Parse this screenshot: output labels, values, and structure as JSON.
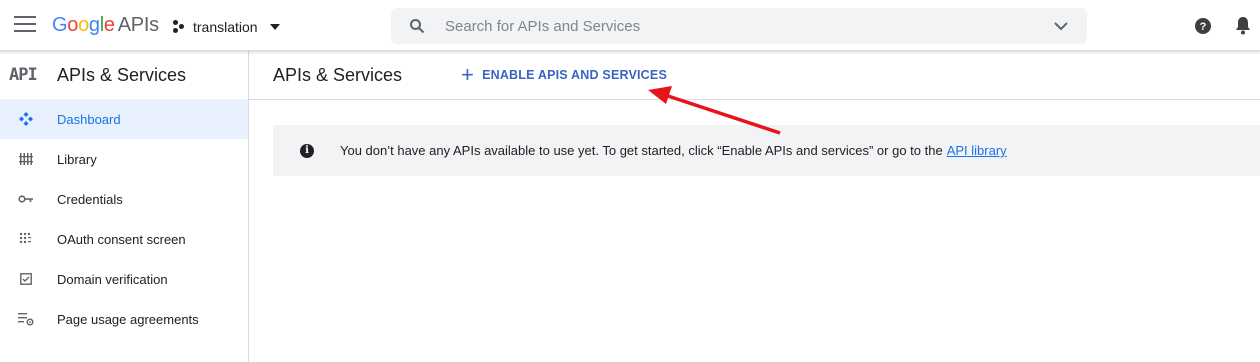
{
  "header": {
    "logo": {
      "g1": "G",
      "o1": "o",
      "o2": "o",
      "g2": "g",
      "l": "l",
      "e": "e",
      "suffix": "APIs"
    },
    "project_name": "translation",
    "search_placeholder": "Search for APIs and Services"
  },
  "sidebar": {
    "logo_text": "API",
    "title": "APIs & Services",
    "items": [
      {
        "label": "Dashboard",
        "icon": "dashboard-icon",
        "active": true
      },
      {
        "label": "Library",
        "icon": "library-icon",
        "active": false
      },
      {
        "label": "Credentials",
        "icon": "key-icon",
        "active": false
      },
      {
        "label": "OAuth consent screen",
        "icon": "oauth-consent-icon",
        "active": false
      },
      {
        "label": "Domain verification",
        "icon": "checkbox-icon",
        "active": false
      },
      {
        "label": "Page usage agreements",
        "icon": "settings-list-icon",
        "active": false
      }
    ]
  },
  "main": {
    "title": "APIs & Services",
    "enable_button": "ENABLE APIS AND SERVICES",
    "banner": {
      "text": "You don’t have any APIs available to use yet. To get started, click “Enable APIs and services” or go to the",
      "link": "API library"
    }
  },
  "colors": {
    "accent": "#1a73e8",
    "active_bg": "#e8f0fe",
    "annotation_arrow": "#e8141c"
  }
}
